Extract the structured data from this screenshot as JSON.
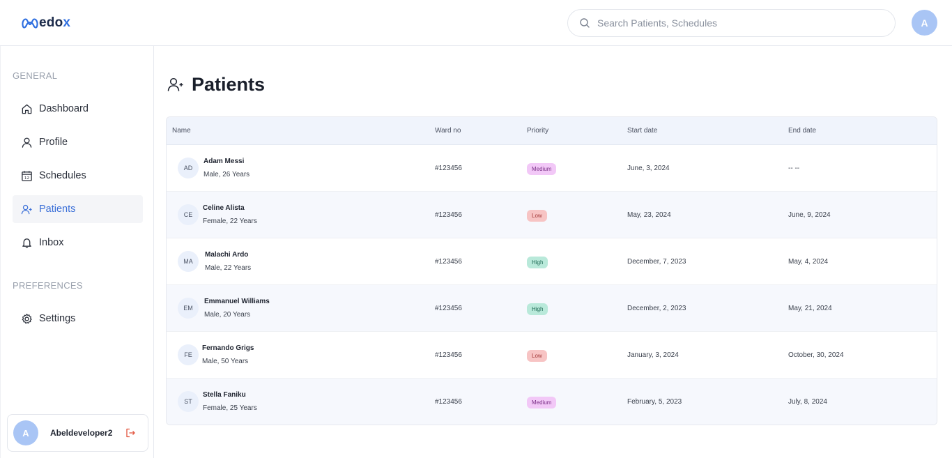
{
  "app": {
    "logo_text": "edox",
    "logo_accent": "x"
  },
  "header": {
    "search_placeholder": "Search Patients, Schedules",
    "avatar_initial": "A"
  },
  "sidebar": {
    "general_label": "GENERAL",
    "preferences_label": "PREFERENCES",
    "items": [
      {
        "label": "Dashboard",
        "icon": "home-icon"
      },
      {
        "label": "Profile",
        "icon": "user-icon"
      },
      {
        "label": "Schedules",
        "icon": "calendar-icon"
      },
      {
        "label": "Patients",
        "icon": "user-plus-icon",
        "active": true
      },
      {
        "label": "Inbox",
        "icon": "bell-icon"
      }
    ],
    "settings": {
      "label": "Settings",
      "icon": "gear-icon"
    },
    "user": {
      "initial": "A",
      "name": "Abeldeveloper2"
    }
  },
  "main": {
    "title": "Patients",
    "columns": [
      "Name",
      "Ward no",
      "Priority",
      "Start date",
      "End date"
    ],
    "rows": [
      {
        "initials": "AD",
        "name": "Adam Messi",
        "meta": "Male, 26 Years",
        "ward": "#123456",
        "priority": "Medium",
        "start": "June, 3, 2024",
        "end": "-- --"
      },
      {
        "initials": "CE",
        "name": "Celine Alista",
        "meta": "Female, 22 Years",
        "ward": "#123456",
        "priority": "Low",
        "start": "May, 23, 2024",
        "end": "June, 9, 2024"
      },
      {
        "initials": "MA",
        "name": "Malachi Ardo",
        "meta": "Male, 22 Years",
        "ward": "#123456",
        "priority": "High",
        "start": "December, 7, 2023",
        "end": "May, 4, 2024"
      },
      {
        "initials": "EM",
        "name": "Emmanuel Williams",
        "meta": "Male, 20 Years",
        "ward": "#123456",
        "priority": "High",
        "start": "December, 2, 2023",
        "end": "May, 21, 2024"
      },
      {
        "initials": "FE",
        "name": "Fernando Grigs",
        "meta": "Male, 50 Years",
        "ward": "#123456",
        "priority": "Low",
        "start": "January, 3, 2024",
        "end": "October, 30, 2024"
      },
      {
        "initials": "ST",
        "name": "Stella Faniku",
        "meta": "Female, 25 Years",
        "ward": "#123456",
        "priority": "Medium",
        "start": "February, 5, 2023",
        "end": "July, 8, 2024"
      }
    ]
  },
  "colors": {
    "accent": "#3a6fd8",
    "priority_medium_bg": "#f2c8f7",
    "priority_low_bg": "#f7c4c4",
    "priority_high_bg": "#b9e9da",
    "logout": "#e2553f"
  }
}
